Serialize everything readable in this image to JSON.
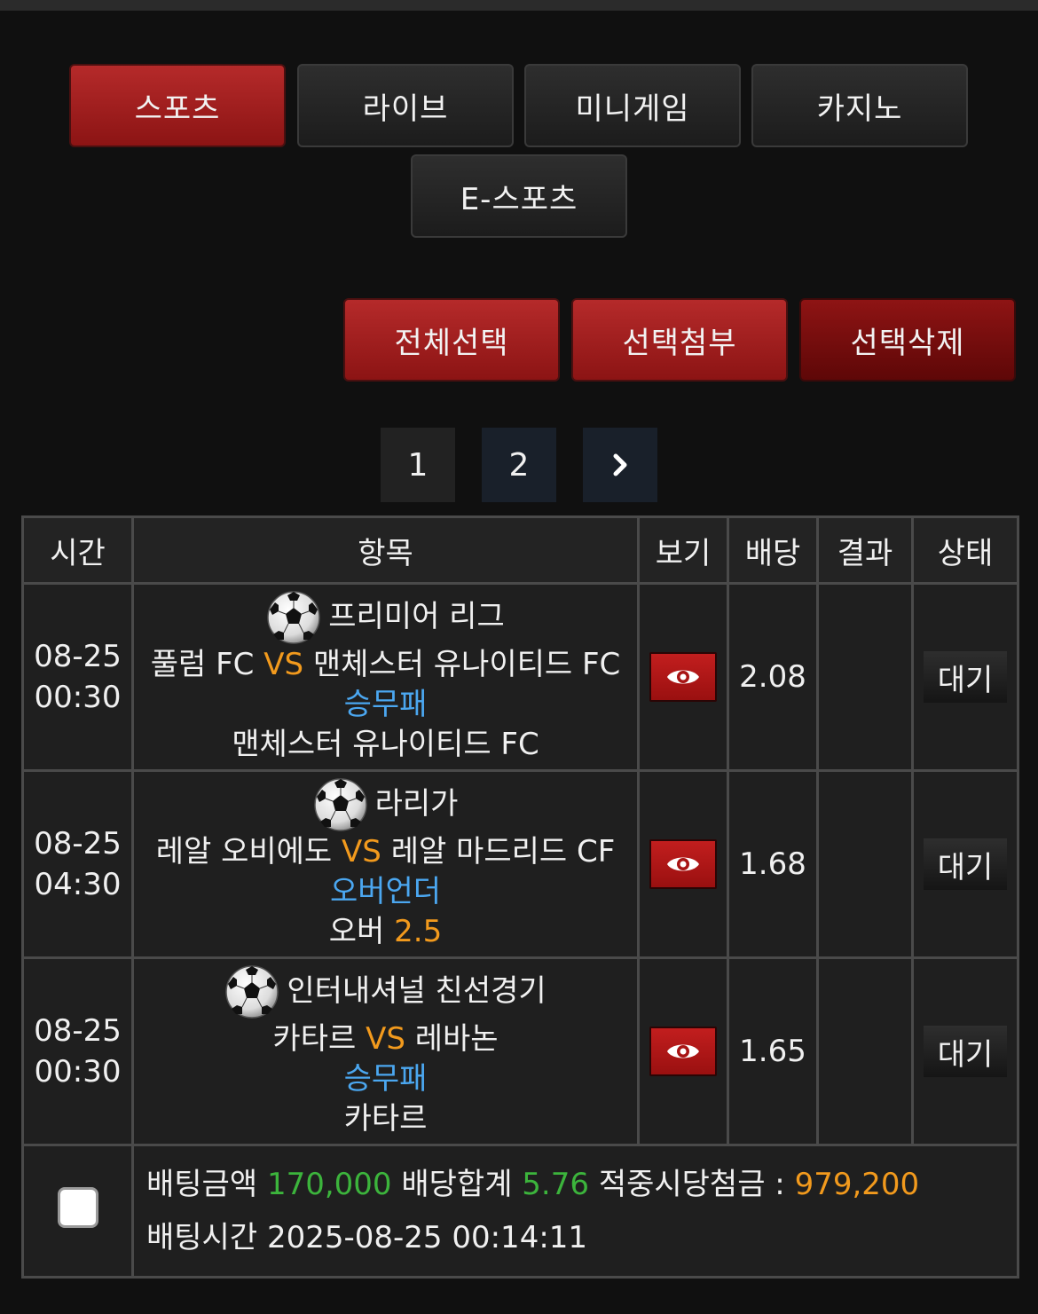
{
  "nav": {
    "tabs": [
      {
        "label": "스포츠"
      },
      {
        "label": "라이브"
      },
      {
        "label": "미니게임"
      },
      {
        "label": "카지노"
      },
      {
        "label": "E-스포츠"
      }
    ]
  },
  "actions": {
    "select_all": "전체선택",
    "attach_selected": "선택첨부",
    "delete_selected": "선택삭제"
  },
  "pagination": {
    "pages": [
      "1",
      "2"
    ],
    "next_icon": "chevron-right-icon"
  },
  "table": {
    "headers": {
      "time": "시간",
      "item": "항목",
      "view": "보기",
      "odds": "배당",
      "result": "결과",
      "status": "상태"
    },
    "rows": [
      {
        "date": "08-25",
        "time": "00:30",
        "league": "프리미어 리그",
        "home": "풀럼 FC",
        "vs": "VS",
        "away": "맨체스터 유나이티드 FC",
        "market": "승무패",
        "pick": "맨체스터 유나이티드 FC",
        "pick_value": "",
        "odds": "2.08",
        "result": "",
        "status": "대기"
      },
      {
        "date": "08-25",
        "time": "04:30",
        "league": "라리가",
        "home": "레알 오비에도",
        "vs": "VS",
        "away": "레알 마드리드 CF",
        "market": "오버언더",
        "pick": "오버",
        "pick_value": "2.5",
        "odds": "1.68",
        "result": "",
        "status": "대기"
      },
      {
        "date": "08-25",
        "time": "00:30",
        "league": "인터내셔널 친선경기",
        "home": "카타르",
        "vs": "VS",
        "away": "레바논",
        "market": "승무패",
        "pick": "카타르",
        "pick_value": "",
        "odds": "1.65",
        "result": "",
        "status": "대기"
      }
    ],
    "summary": {
      "bet_amount_label": "배팅금액",
      "bet_amount": "170,000",
      "odds_total_label": "배당합계",
      "odds_total": "5.76",
      "payout_label": "적중시당첨금 :",
      "payout": "979,200",
      "bet_time_label": "배팅시간",
      "bet_time": "2025-08-25 00:14:11"
    }
  },
  "colors": {
    "accent_red": "#a81e1e",
    "vs_orange": "#f29a1d",
    "market_blue": "#4ba7f0",
    "odds_green": "#3cb43c"
  }
}
